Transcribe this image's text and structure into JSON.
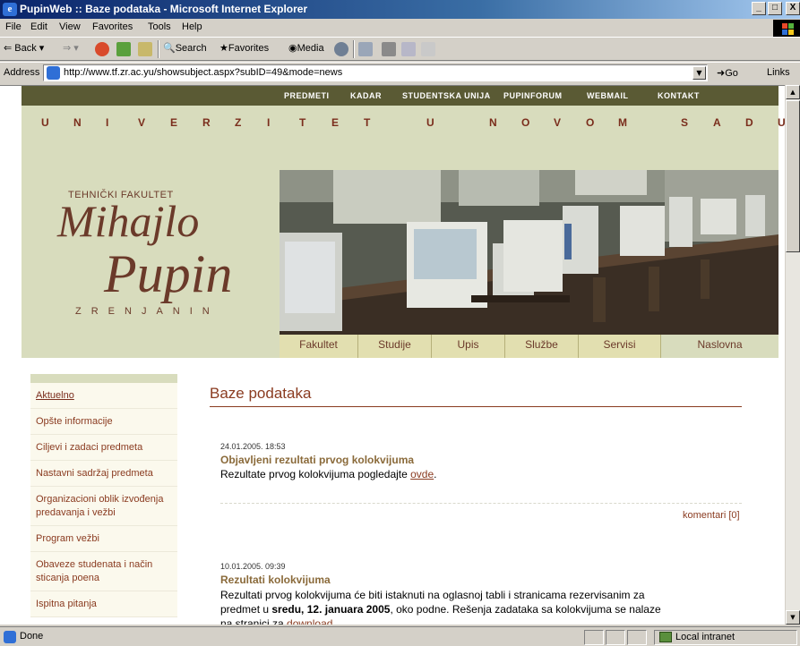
{
  "window": {
    "title": "PupinWeb :: Baze podataka - Microsoft Internet Explorer",
    "buttons": {
      "minimize": "_",
      "maximize": "□",
      "close": "X"
    }
  },
  "menu": [
    "File",
    "Edit",
    "View",
    "Favorites",
    "Tools",
    "Help"
  ],
  "toolbar": {
    "back": "Back",
    "search": "Search",
    "favorites": "Favorites",
    "media": "Media"
  },
  "address": {
    "label": "Address",
    "url": "http://www.tf.zr.ac.yu/showsubject.aspx?subID=49&mode=news",
    "go": "Go",
    "links": "Links"
  },
  "site": {
    "topnav": [
      "PREDMETI",
      "KADAR",
      "STUDENTSKA UNIJA",
      "PUPINFORUM",
      "WEBMAIL",
      "KONTAKT"
    ],
    "university_letters": [
      "U",
      "N",
      "I",
      "V",
      "E",
      "R",
      "Z",
      "I",
      "T",
      "E",
      "T",
      "U",
      "N",
      "O",
      "V",
      "O",
      "M",
      "S",
      "A",
      "D",
      "U"
    ],
    "logo": {
      "faculty": "TEHNIČKI FAKULTET",
      "line1": "Mihajlo",
      "line2": "Pupin",
      "city": "ZRENJANIN"
    },
    "subnav": [
      "Fakultet",
      "Studije",
      "Upis",
      "Službe",
      "Servisi",
      "Naslovna"
    ],
    "sidebar": [
      "Aktuelno",
      "Opšte informacije",
      "Ciljevi i zadaci predmeta",
      "Nastavni sadržaj predmeta",
      "Organizacioni oblik izvođenja predavanja i vežbi",
      "Program vežbi",
      "Obaveze studenata i način sticanja poena",
      "Ispitna pitanja"
    ],
    "main": {
      "title": "Baze podataka",
      "news": [
        {
          "date": "24.01.2005. 18:53",
          "title": "Objavljeni rezultati prvog kolokvijuma",
          "body_before": "Rezultate prvog kolokvijuma pogledajte ",
          "link": "ovde",
          "body_after": ".",
          "comments": "komentari [0]"
        },
        {
          "date": "10.01.2005. 09:39",
          "title": "Rezultati kolokvijuma",
          "body_1": "Rezultati prvog kolokvijuma će biti istaknuti na oglasnoj tabli i stranicama rezervisanim za",
          "body_2_before": "predmet u ",
          "body_2_bold": "sredu, 12. januara 2005",
          "body_2_after": ", oko podne. Rešenja zadataka sa kolokvijuma se nalaze",
          "body_3_before": "na stranici za ",
          "body_3_link": "download"
        }
      ]
    }
  },
  "status": {
    "text": "Done",
    "zone": "Local intranet"
  }
}
